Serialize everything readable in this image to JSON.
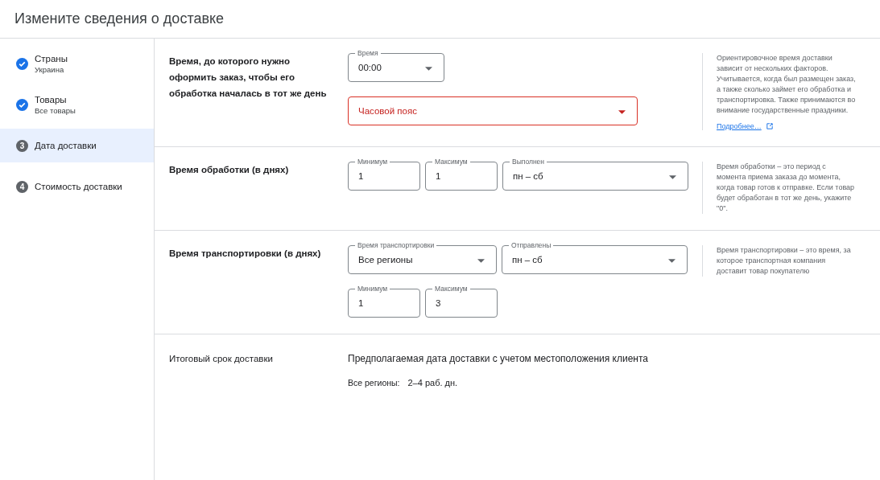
{
  "title": "Измените сведения о доставке",
  "steps": [
    {
      "kind": "done",
      "label": "Страны",
      "sublabel": "Украина",
      "selected": false
    },
    {
      "kind": "done",
      "label": "Товары",
      "sublabel": "Все товары",
      "selected": false
    },
    {
      "kind": "pending",
      "number": "3",
      "label": "Дата доставки",
      "selected": true
    },
    {
      "kind": "pending",
      "number": "4",
      "label": "Стоимость доставки",
      "selected": false
    }
  ],
  "sections": [
    {
      "label": "Время, до которого нужно оформить заказ, чтобы его обработка началась в тот же день",
      "rows": [
        [
          {
            "kind": "select",
            "label": "Время",
            "value": "00:00",
            "error": false
          }
        ],
        [
          {
            "kind": "select",
            "placeholder": "Часовой пояс",
            "error": true
          }
        ]
      ],
      "help": "Ориентировочное время доставки зависит от нескольких факторов. Учитывается, когда был размещен заказ, а также сколько займет его обработка и транспортировка. Также принимаются во внимание государственные праздники.",
      "link": "Подробнее…"
    },
    {
      "label": "Время обработки (в днях)",
      "rows": [
        [
          {
            "kind": "input",
            "label": "Минимум",
            "value": "1",
            "error": false
          },
          {
            "kind": "input",
            "label": "Максимум",
            "value": "1",
            "error": false
          },
          {
            "kind": "select",
            "label": "Выполнен",
            "value": "пн – сб",
            "error": false
          }
        ]
      ],
      "help": "Время обработки – это период с момента приема заказа до момента, когда товар готов к отправке. Если товар будет обработан в тот же день, укажите \"0\"."
    },
    {
      "label": "Время транспортировки (в днях)",
      "rows": [
        [
          {
            "kind": "select",
            "label": "Время транспортировки",
            "value": "Все регионы",
            "error": false
          },
          {
            "kind": "select",
            "label": "Отправлены",
            "value": "пн – сб",
            "error": false
          }
        ],
        [
          {
            "kind": "input",
            "label": "Минимум",
            "value": "1",
            "error": false
          },
          {
            "kind": "input",
            "label": "Максимум",
            "value": "3",
            "error": false
          }
        ]
      ],
      "help": "Время транспортировки – это время, за которое транспортная компания доставит товар покупателю"
    }
  ],
  "summary": {
    "label": "Итоговый срок доставки",
    "heading": "Предполагаемая дата доставки с учетом местоположения клиента",
    "region": "Все регионы:",
    "days": "2–4 раб. дн."
  }
}
